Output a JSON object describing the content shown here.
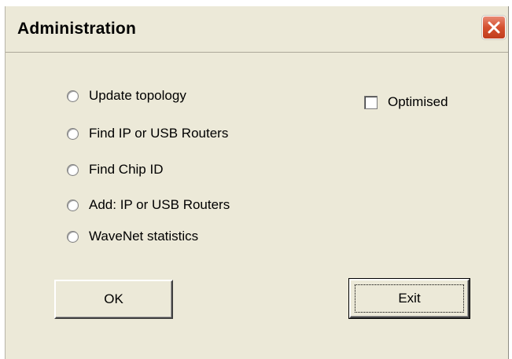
{
  "window": {
    "title": "Administration"
  },
  "icons": {
    "close": "close-icon"
  },
  "colors": {
    "dialog_background": "#ece9d8",
    "close_button": "#d4502f"
  },
  "options": [
    {
      "label": "Update topology",
      "selected": false
    },
    {
      "label": "Find IP or USB Routers",
      "selected": false
    },
    {
      "label": "Find Chip ID",
      "selected": false
    },
    {
      "label": "Add: IP or USB Routers",
      "selected": false
    },
    {
      "label": "WaveNet statistics",
      "selected": false
    }
  ],
  "optimised": {
    "label": "Optimised",
    "checked": false
  },
  "buttons": {
    "ok_label": "OK",
    "exit_label": "Exit"
  }
}
